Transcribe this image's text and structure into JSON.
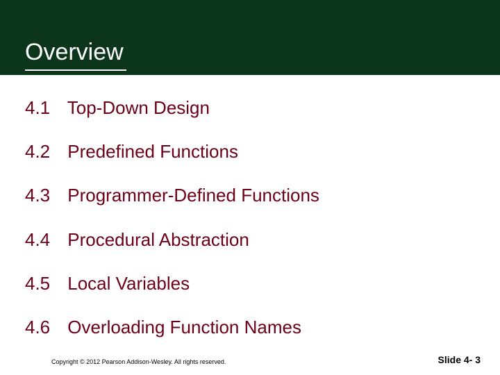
{
  "title": "Overview",
  "items": [
    {
      "num": "4.1",
      "label": "Top-Down Design"
    },
    {
      "num": "4.2",
      "label": "Predefined Functions"
    },
    {
      "num": "4.3",
      "label": "Programmer-Defined Functions"
    },
    {
      "num": "4.4",
      "label": "Procedural Abstraction"
    },
    {
      "num": "4.5",
      "label": "Local Variables"
    },
    {
      "num": "4.6",
      "label": "Overloading Function Names"
    }
  ],
  "footer": {
    "copyright": "Copyright © 2012 Pearson Addison-Wesley. All rights reserved.",
    "slide_number": "Slide 4- 3"
  },
  "colors": {
    "header_bg": "#0b361c",
    "item_text": "#6b0018"
  }
}
